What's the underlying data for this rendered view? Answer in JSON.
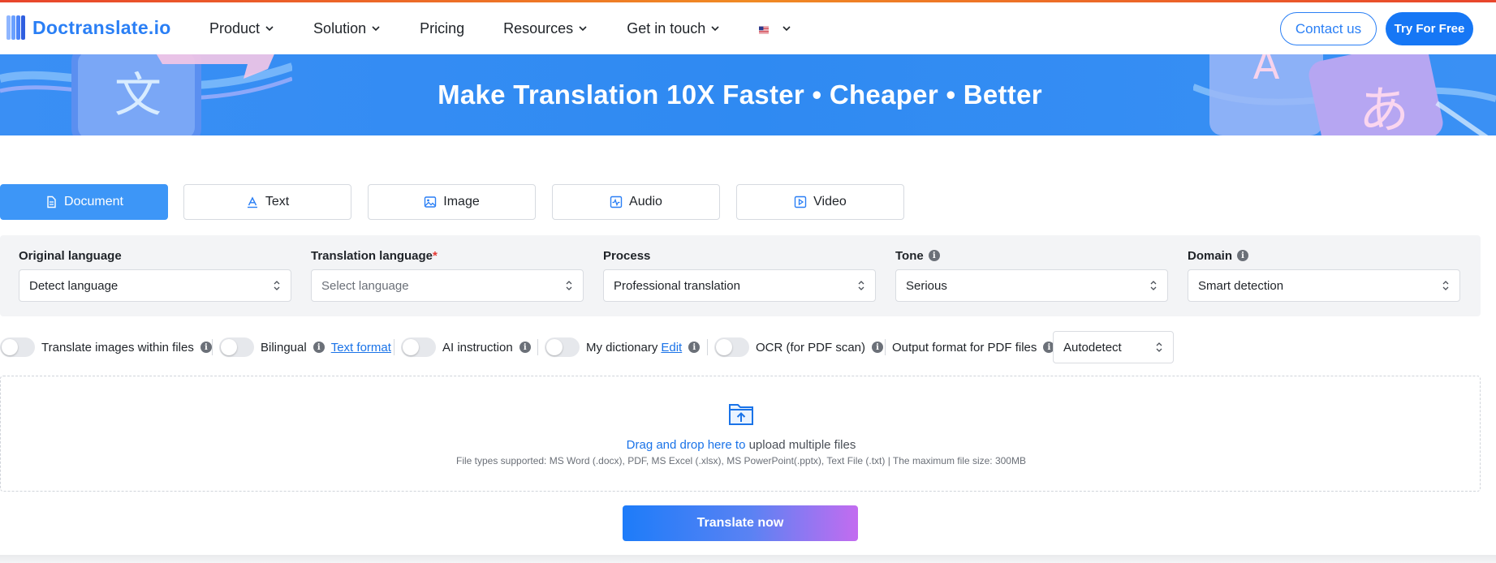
{
  "brand": {
    "name": "Doctranslate.io",
    "accent": "#2a7ff5"
  },
  "nav": {
    "items": [
      {
        "label": "Product",
        "dropdown": true
      },
      {
        "label": "Solution",
        "dropdown": true
      },
      {
        "label": "Pricing",
        "dropdown": false
      },
      {
        "label": "Resources",
        "dropdown": true
      },
      {
        "label": "Get in touch",
        "dropdown": true
      }
    ],
    "language_icon": "us-flag-icon",
    "contact_label": "Contact us",
    "try_label": "Try For Free"
  },
  "banner": {
    "title": "Make Translation 10X Faster • Cheaper • Better"
  },
  "tabs": [
    {
      "label": "Document",
      "icon": "document-icon",
      "active": true
    },
    {
      "label": "Text",
      "icon": "text-icon",
      "active": false
    },
    {
      "label": "Image",
      "icon": "image-icon",
      "active": false
    },
    {
      "label": "Audio",
      "icon": "audio-icon",
      "active": false
    },
    {
      "label": "Video",
      "icon": "video-icon",
      "active": false
    }
  ],
  "settings": {
    "original": {
      "label": "Original language",
      "value": "Detect language"
    },
    "translation": {
      "label": "Translation language",
      "required_mark": "*",
      "placeholder": "Select language"
    },
    "process": {
      "label": "Process",
      "value": "Professional translation"
    },
    "tone": {
      "label": "Tone",
      "value": "Serious"
    },
    "domain": {
      "label": "Domain",
      "value": "Smart detection"
    }
  },
  "options": {
    "translate_images": "Translate images within files",
    "bilingual": "Bilingual",
    "text_format_link": "Text format",
    "ai_instruction": "AI instruction",
    "my_dictionary": "My dictionary",
    "edit_link": "Edit",
    "ocr": "OCR (for PDF scan)",
    "output_format_label": "Output format for PDF files",
    "output_format_value": "Autodetect"
  },
  "dropzone": {
    "highlight": "Drag and drop here to",
    "rest": " upload multiple files",
    "types": "File types supported: MS Word (.docx), PDF, MS Excel (.xlsx), MS PowerPoint(.pptx), Text File (.txt) | The maximum file size: 300MB"
  },
  "translate_button": "Translate now"
}
